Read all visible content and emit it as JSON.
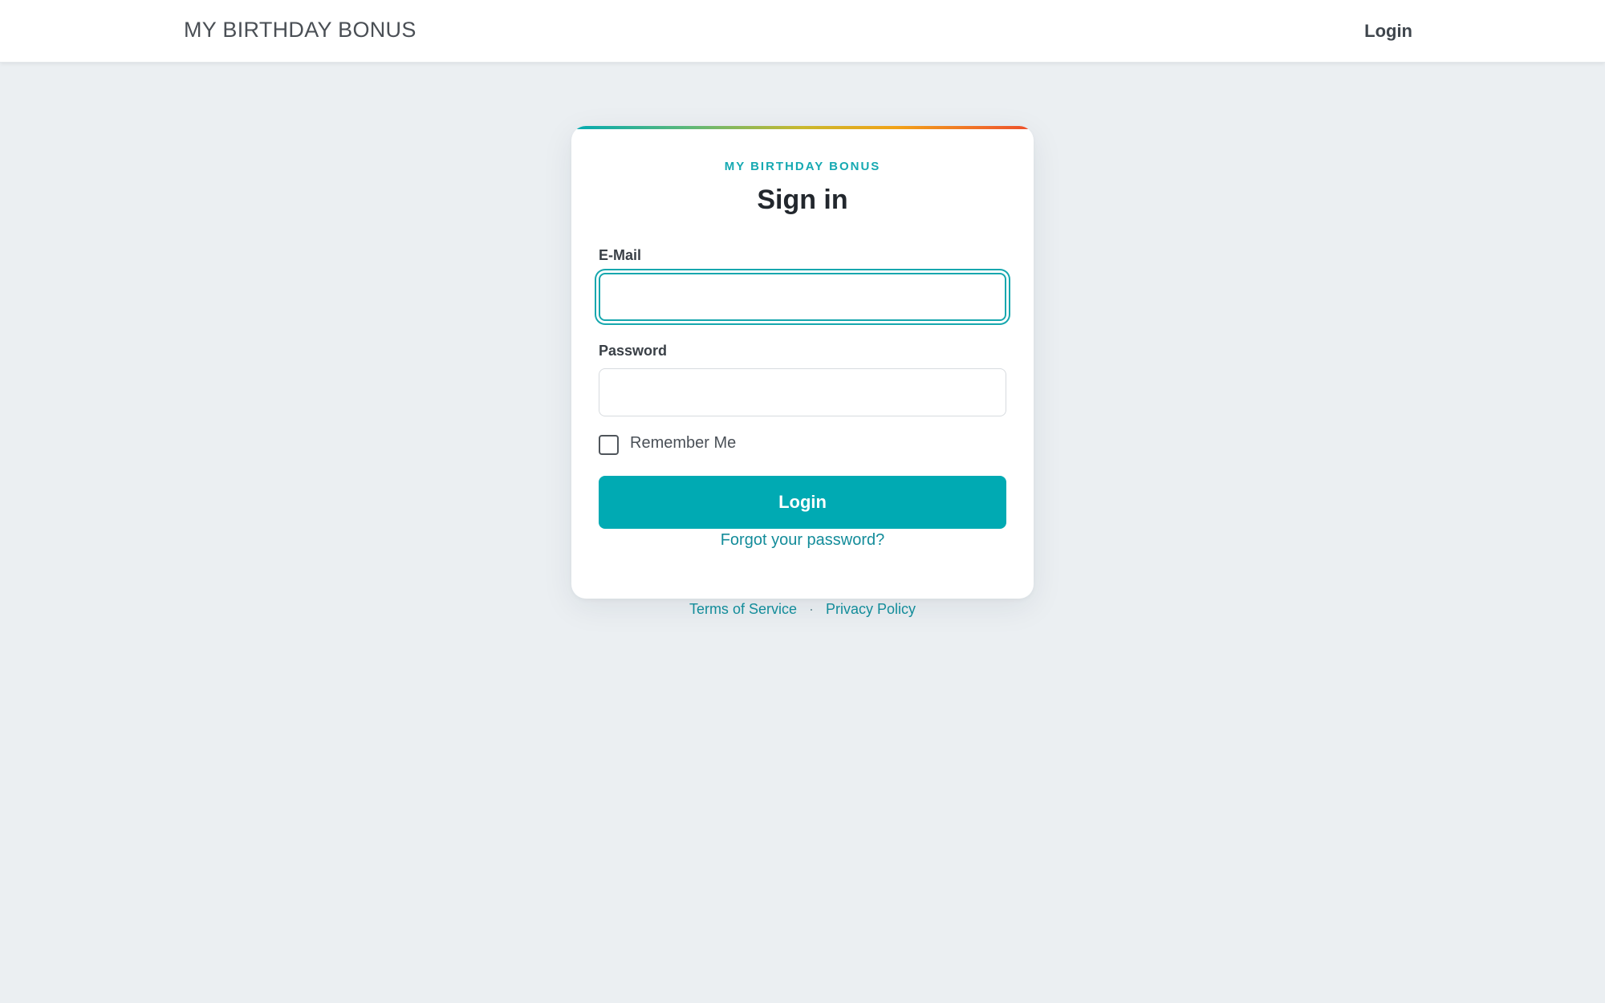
{
  "navbar": {
    "brand": "MY BIRTHDAY BONUS",
    "login_link": "Login"
  },
  "card": {
    "eyebrow": "MY BIRTHDAY BONUS",
    "title": "Sign in",
    "email": {
      "label": "E-Mail",
      "value": "",
      "placeholder": ""
    },
    "password": {
      "label": "Password",
      "value": "",
      "placeholder": ""
    },
    "remember_me": {
      "label": "Remember Me",
      "checked": false
    },
    "login_button": "Login",
    "forgot_password": "Forgot your password?"
  },
  "footer": {
    "terms": "Terms of Service",
    "separator": "·",
    "privacy": "Privacy Policy"
  },
  "colors": {
    "accent": "#00aab3",
    "link": "#138c9a",
    "background": "#ebeff2"
  }
}
